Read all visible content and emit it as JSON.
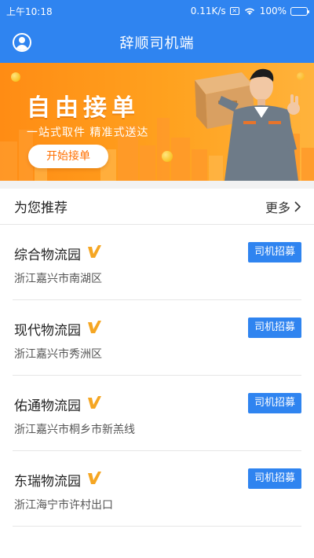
{
  "status_bar": {
    "time": "上午10:18",
    "network_speed": "0.11K/s",
    "battery_percent": "100%",
    "battery_level": 1.0
  },
  "app_bar": {
    "title": "辞顺司机端",
    "profile_icon": "user-circle-icon"
  },
  "banner": {
    "headline": "自由接单",
    "subheadline": "一站式取件 精准式送达",
    "cta_label": "开始接单",
    "colors": {
      "start": "#ff8c14",
      "end": "#ffb33c"
    }
  },
  "section": {
    "title": "为您推荐",
    "more_label": "更多"
  },
  "recommendations": [
    {
      "name": "综合物流园",
      "address": "浙江嘉兴市南湖区",
      "action": "司机招募",
      "verified": true
    },
    {
      "name": "现代物流园",
      "address": "浙江嘉兴市秀洲区",
      "action": "司机招募",
      "verified": true
    },
    {
      "name": "佑通物流园",
      "address": "浙江嘉兴市桐乡市新羔线",
      "action": "司机招募",
      "verified": true
    },
    {
      "name": "东瑞物流园",
      "address": "浙江海宁市许村出口",
      "action": "司机招募",
      "verified": true
    }
  ],
  "colors": {
    "primary": "#2f84f0",
    "verified_badge": "#f5a623"
  }
}
